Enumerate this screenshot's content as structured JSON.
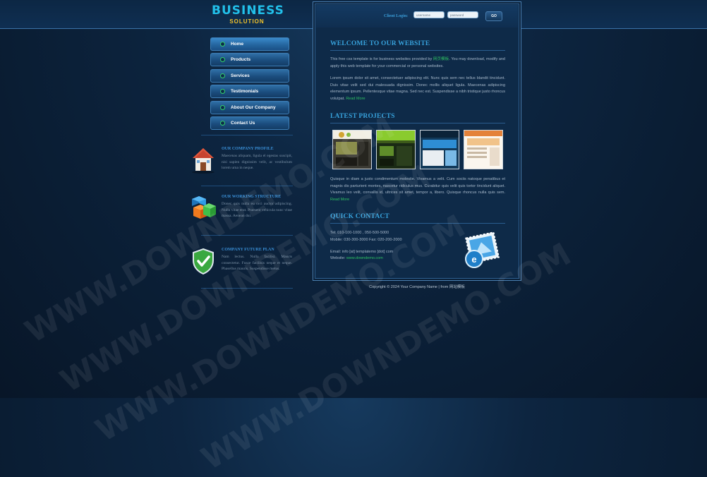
{
  "logo": {
    "main": "BUSINESS",
    "sub": "SOLUTION"
  },
  "nav": [
    {
      "label": "Home"
    },
    {
      "label": "Products"
    },
    {
      "label": "Services"
    },
    {
      "label": "Testimonials"
    },
    {
      "label": "About Our Company"
    },
    {
      "label": "Contact Us"
    }
  ],
  "side": {
    "profile": {
      "title": "OUR COMPANY PROFILE",
      "body": "Maecenas aliquam, ligula el egestas suscipit, nisi sapien dignissim velit, ac vestibulum lorem urna in neque."
    },
    "structure": {
      "title": "OUR WORKING STRUCTURE",
      "body": "Donec quis nulla eu orci auctor adipiscing. Nulla vitae erat. Praesent vehicula nunc vitae massa. Aenean dui."
    },
    "plan": {
      "title": "COMPANY FUTURE PLAN",
      "body": "Nam lectus. Nulla facilisi. Mauris consectetur. Fusce facilisis neque et neque. Phasellus mauris. Suspendisse metus."
    }
  },
  "login": {
    "label": "Client Login:",
    "username": "username",
    "password": "password",
    "go": "GO"
  },
  "welcome": {
    "title": "WELCOME TO OUR WEBSITE",
    "p1_a": "This free css template is for business websites provided by ",
    "p1_link": "网页模板",
    "p1_b": ". You may download, modify and apply this web template for your commercial or personal websites.",
    "p2": "Lorem ipsum dolor sit amet, consectetuer adipiscing elit. Nunc quis sem nec tellus blandit tincidunt. Duis vitae velit sed dui malesuada dignissim. Donec mollis aliquet ligula. Maecenas adipiscing elementum ipsum. Pellentesque vitae magna. Sed nec est. Suspendisse a nibh tristique justo rhoncus volutpat. ",
    "read_more": "Read More"
  },
  "projects": {
    "title": "LATEST PROJECTS",
    "p": "Quisque in diam a justo condimentum molestie. Vivamus a velit. Cum sociis natoque penatibus et magnis dis parturient montes, nascetur ridiculus mus. Curabitur quis velit quis tortor tincidunt aliquet. Vivamus leo velit, convallis id, ultrices sit amet, tempor a, libero. Quisque rhoncus nulla quis sem. ",
    "read_more": "Read More"
  },
  "contact": {
    "title": "QUICK CONTACT",
    "tel": "Tel: 010-100-1000 , 050-500-5000",
    "mobile": "Mobile: 030-300-3000 Fax: 020-200-2000",
    "email": "Email: info [at] templatemo [dot] com",
    "website_label": "Website: ",
    "website": "www.downdemo.com"
  },
  "footer": {
    "copyright": "Copyright © 2024 Your Company Name | from 网站模板"
  },
  "watermark": "WWW.DOWNDEMO.COM",
  "colors": {
    "background": "#0a1d33",
    "accent": "#37a2dc",
    "link_green": "#2fc062",
    "logo_yellow": "#f3c42b"
  }
}
